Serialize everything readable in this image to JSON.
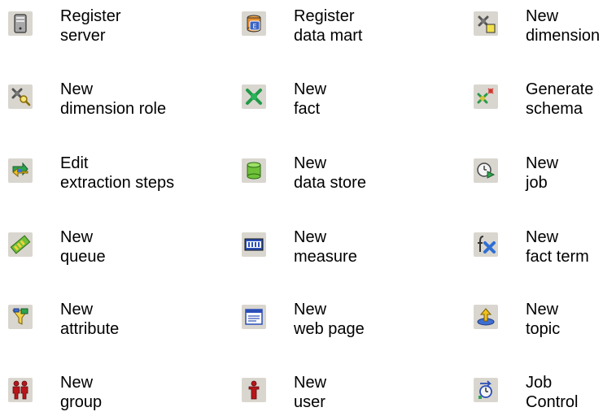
{
  "items": [
    {
      "line1": "Register",
      "line2": "server",
      "icon": "server-icon"
    },
    {
      "line1": "Register",
      "line2": "data mart",
      "icon": "data-mart-icon"
    },
    {
      "line1": "New",
      "line2": "dimension",
      "icon": "new-dimension-icon"
    },
    {
      "line1": "New",
      "line2": "dimension role",
      "icon": "dimension-role-icon"
    },
    {
      "line1": "New",
      "line2": "fact",
      "icon": "fact-icon"
    },
    {
      "line1": "Generate",
      "line2": "schema",
      "icon": "generate-schema-icon"
    },
    {
      "line1": "Edit",
      "line2": "extraction steps",
      "icon": "extraction-steps-icon"
    },
    {
      "line1": "New",
      "line2": "data store",
      "icon": "data-store-icon"
    },
    {
      "line1": "New",
      "line2": "job",
      "icon": "job-icon"
    },
    {
      "line1": "New",
      "line2": "queue",
      "icon": "queue-icon"
    },
    {
      "line1": "New",
      "line2": "measure",
      "icon": "measure-icon"
    },
    {
      "line1": "New",
      "line2": "fact term",
      "icon": "fact-term-icon"
    },
    {
      "line1": "New",
      "line2": "attribute",
      "icon": "attribute-icon"
    },
    {
      "line1": "New",
      "line2": "web page",
      "icon": "web-page-icon"
    },
    {
      "line1": "New",
      "line2": "topic",
      "icon": "topic-icon"
    },
    {
      "line1": "New",
      "line2": "group",
      "icon": "group-icon"
    },
    {
      "line1": "New",
      "line2": "user",
      "icon": "user-icon"
    },
    {
      "line1": "Job",
      "line2": "Control",
      "icon": "job-control-icon"
    }
  ]
}
